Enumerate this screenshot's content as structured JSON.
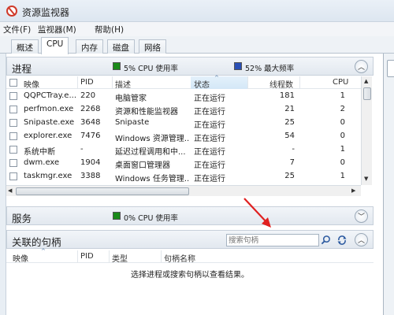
{
  "window": {
    "title": "资源监视器"
  },
  "menu": [
    "文件(F)",
    "监视器(M)",
    "帮助(H)"
  ],
  "tabs": [
    "概述",
    "CPU",
    "内存",
    "磁盘",
    "网络"
  ],
  "processes": {
    "title": "进程",
    "cpu_usage": "5% CPU 使用率",
    "max_freq": "52% 最大频率",
    "legend_colors": {
      "cpu": "#1a8a1a",
      "freq": "#2a4fb5"
    },
    "columns": [
      "映像",
      "PID",
      "描述",
      "状态",
      "线程数",
      "CPU"
    ],
    "rows": [
      {
        "image": "QQPCTray.e...",
        "pid": "220",
        "desc": "电脑管家",
        "status": "正在运行",
        "threads": "181",
        "cpu": "1"
      },
      {
        "image": "perfmon.exe",
        "pid": "2268",
        "desc": "资源和性能监视器",
        "status": "正在运行",
        "threads": "21",
        "cpu": "2"
      },
      {
        "image": "Snipaste.exe",
        "pid": "3648",
        "desc": "Snipaste",
        "status": "正在运行",
        "threads": "25",
        "cpu": "0"
      },
      {
        "image": "explorer.exe",
        "pid": "7476",
        "desc": "Windows 资源管理...",
        "status": "正在运行",
        "threads": "54",
        "cpu": "0"
      },
      {
        "image": "系统中断",
        "pid": "-",
        "desc": "延迟过程调用和中...",
        "status": "正在运行",
        "threads": "-",
        "cpu": "1"
      },
      {
        "image": "dwm.exe",
        "pid": "1904",
        "desc": "桌面窗口管理器",
        "status": "正在运行",
        "threads": "7",
        "cpu": "0"
      },
      {
        "image": "taskmgr.exe",
        "pid": "3388",
        "desc": "Windows 任务管理...",
        "status": "正在运行",
        "threads": "25",
        "cpu": "1"
      }
    ]
  },
  "services": {
    "title": "服务",
    "cpu_usage": "0% CPU 使用率"
  },
  "handles": {
    "title": "关联的句柄",
    "search_placeholder": "搜索句柄",
    "columns": [
      "映像",
      "PID",
      "类型",
      "句柄名称"
    ],
    "empty_message": "选择进程或搜索句柄以查看结果。"
  },
  "annotation_color": "#e02020"
}
